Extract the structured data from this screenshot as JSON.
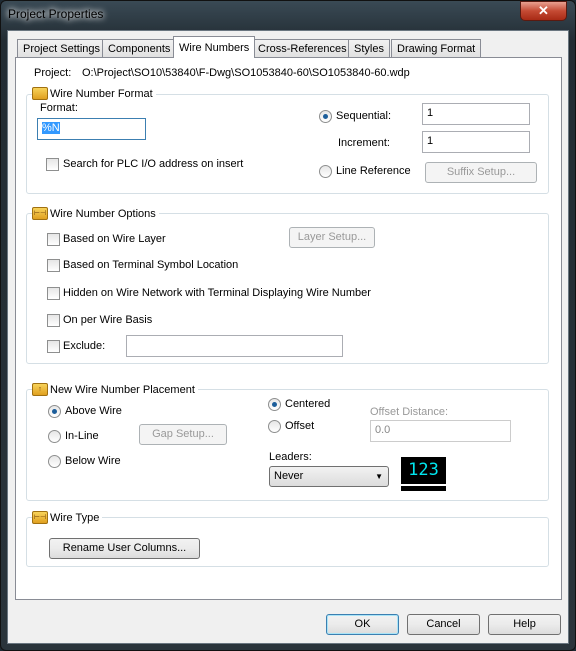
{
  "window": {
    "title": "Project Properties",
    "close_icon": "close-icon"
  },
  "tabs": [
    {
      "label": "Project Settings"
    },
    {
      "label": "Components"
    },
    {
      "label": "Wire Numbers",
      "selected": true
    },
    {
      "label": "Cross-References"
    },
    {
      "label": "Styles"
    },
    {
      "label": "Drawing Format"
    }
  ],
  "project": {
    "label": "Project:",
    "path": "O:\\Project\\SO10\\53840\\F-Dwg\\SO1053840-60\\SO1053840-60.wdp"
  },
  "format_group": {
    "title": "Wire Number Format",
    "format_label": "Format:",
    "format_value": "%N",
    "plc_search": {
      "label": "Search for PLC I/O address on insert",
      "checked": false
    },
    "sequential": {
      "label": "Sequential:",
      "selected": true,
      "value": "1"
    },
    "increment": {
      "label": "Increment:",
      "value": "1"
    },
    "line_reference": {
      "label": "Line Reference",
      "selected": false
    },
    "suffix_setup": "Suffix Setup..."
  },
  "options_group": {
    "title": "Wire Number Options",
    "items": [
      {
        "label": "Based on Wire Layer",
        "checked": false
      },
      {
        "label": "Based on Terminal Symbol Location",
        "checked": false
      },
      {
        "label": "Hidden on Wire Network with Terminal Displaying Wire Number",
        "checked": false
      },
      {
        "label": "On per Wire Basis",
        "checked": false
      },
      {
        "label": "Exclude:",
        "checked": false
      }
    ],
    "layer_setup": "Layer Setup...",
    "exclude_value": ""
  },
  "placement_group": {
    "title": "New Wire Number Placement",
    "above": {
      "label": "Above Wire",
      "selected": true
    },
    "inline": {
      "label": "In-Line",
      "selected": false
    },
    "below": {
      "label": "Below Wire",
      "selected": false
    },
    "gap_setup": "Gap Setup...",
    "centered": {
      "label": "Centered",
      "selected": true
    },
    "offset": {
      "label": "Offset",
      "selected": false
    },
    "offset_distance_label": "Offset Distance:",
    "offset_distance_value": "0.0",
    "leaders_label": "Leaders:",
    "leaders_value": "Never",
    "preview_text": "123",
    "preview_color": "#00e5ee"
  },
  "wire_type_group": {
    "title": "Wire Type",
    "rename": "Rename User Columns..."
  },
  "buttons": {
    "ok": "OK",
    "cancel": "Cancel",
    "help": "Help"
  }
}
